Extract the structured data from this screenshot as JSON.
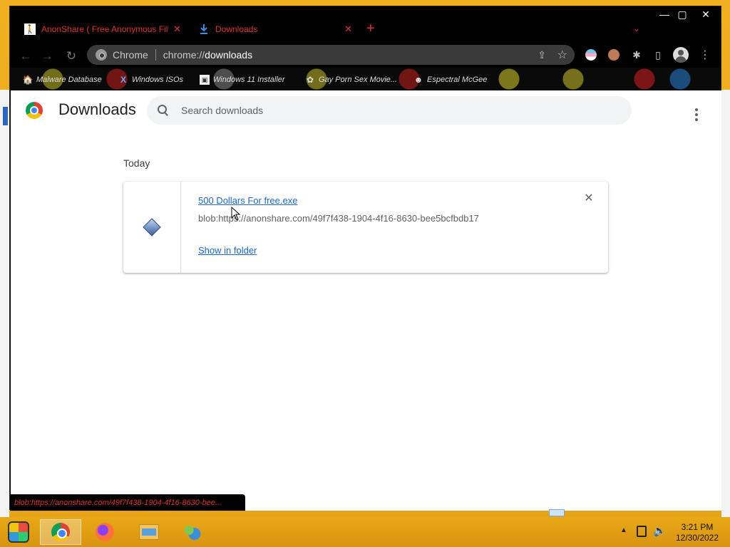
{
  "window": {
    "tabs": [
      {
        "title": "AnonShare ( Free Anonymous Fil",
        "close": "✕"
      },
      {
        "title": "Downloads",
        "close": "✕"
      }
    ],
    "new_tab": "+",
    "controls": {
      "minimize": "—",
      "maximize": "▢",
      "close": "✕"
    }
  },
  "toolbar": {
    "back": "←",
    "forward": "→",
    "reload": "↻",
    "omnibox": {
      "origin_label": "Chrome",
      "url_scheme": "chrome://",
      "url_host": "downloads"
    },
    "share": "⇪",
    "star": "☆",
    "puzzle": "✱",
    "sidepanel": "▯",
    "menu": "⋮"
  },
  "bookmarks": [
    {
      "label": "Malware Database",
      "icon": "🏠"
    },
    {
      "label": "Windows ISOs",
      "icon": "X"
    },
    {
      "label": "Windows 11 Installer",
      "icon": "▣"
    },
    {
      "label": "Gay Porn Sex Movie...",
      "icon": "✿"
    },
    {
      "label": "Espectral McGee",
      "icon": "☻"
    }
  ],
  "page": {
    "title": "Downloads",
    "search_placeholder": "Search downloads",
    "section": "Today",
    "download": {
      "file_name": "500 Dollars For free.exe",
      "url": "blob:https://anonshare.com/49f7f438-1904-4f16-8630-bee5bcfbdb17",
      "action": "Show in folder",
      "remove": "✕"
    }
  },
  "status_bar": {
    "text": "blob:https://anonshare.com/49f7f438-1904-4f16-8630-bee..."
  },
  "taskbar": {
    "apps": [
      "Google Chrome",
      "Firefox",
      "File Explorer",
      "Network"
    ],
    "tray_arrow": "▲",
    "volume": "🔈",
    "time": "3:21 PM",
    "date": "12/30/2022"
  }
}
